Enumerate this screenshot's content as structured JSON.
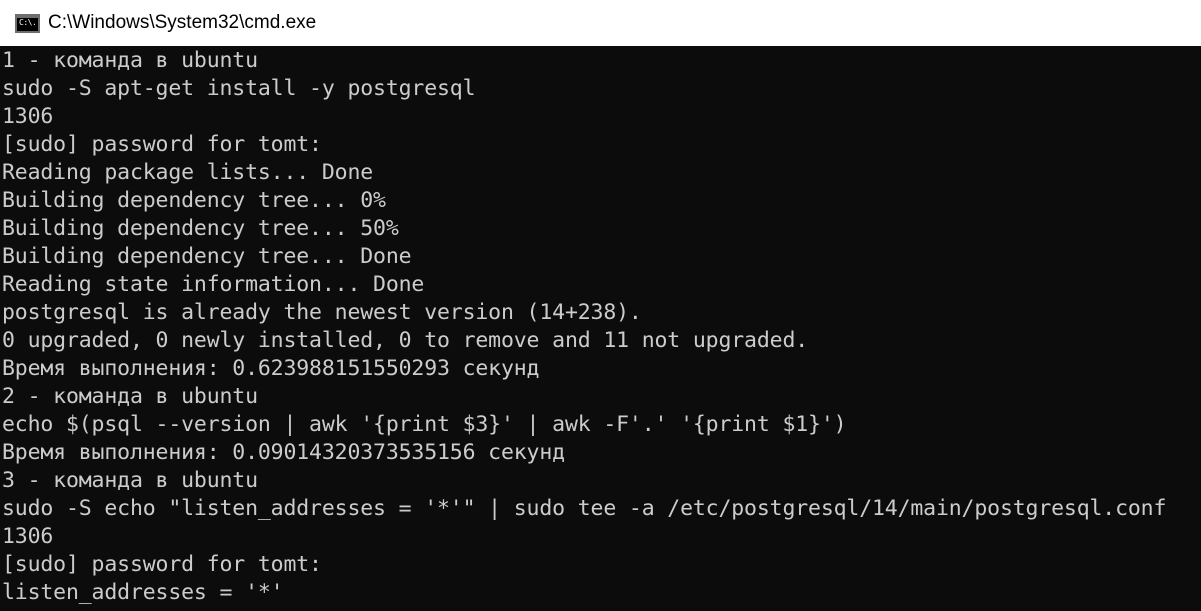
{
  "window": {
    "title": "C:\\Windows\\System32\\cmd.exe",
    "icon": "cmd-icon",
    "icon_glyph": "C:\\."
  },
  "console": {
    "lines": [
      "1 - команда в ubuntu",
      "sudo -S apt-get install -y postgresql",
      "1306",
      "[sudo] password for tomt:",
      "Reading package lists... Done",
      "Building dependency tree... 0%",
      "Building dependency tree... 50%",
      "Building dependency tree... Done",
      "Reading state information... Done",
      "postgresql is already the newest version (14+238).",
      "0 upgraded, 0 newly installed, 0 to remove and 11 not upgraded.",
      "Время выполнения: 0.623988151550293 секунд",
      "2 - команда в ubuntu",
      "echo $(psql --version | awk '{print $3}' | awk -F'.' '{print $1}')",
      "Время выполнения: 0.09014320373535156 секунд",
      "3 - команда в ubuntu",
      "sudo -S echo \"listen_addresses = '*'\" | sudo tee -a /etc/postgresql/14/main/postgresql.conf",
      "1306",
      "[sudo] password for tomt:",
      "listen_addresses = '*'"
    ]
  },
  "colors": {
    "console_background": "#0c0c0c",
    "console_text": "#cccccc",
    "titlebar_background": "#ffffff",
    "titlebar_text": "#000000"
  }
}
